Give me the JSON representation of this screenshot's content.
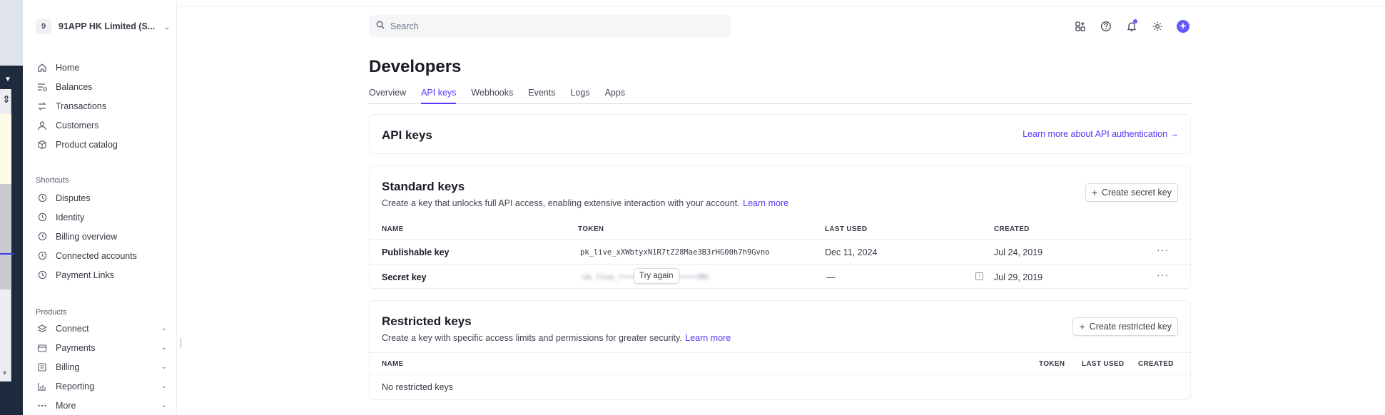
{
  "account": {
    "initial": "9",
    "name": "91APP HK Limited (S..."
  },
  "nav_main": [
    {
      "label": "Home",
      "icon": "home-icon"
    },
    {
      "label": "Balances",
      "icon": "balances-icon"
    },
    {
      "label": "Transactions",
      "icon": "transactions-icon"
    },
    {
      "label": "Customers",
      "icon": "customers-icon"
    },
    {
      "label": "Product catalog",
      "icon": "product-catalog-icon"
    }
  ],
  "shortcuts": {
    "title": "Shortcuts",
    "items": [
      {
        "label": "Disputes"
      },
      {
        "label": "Identity"
      },
      {
        "label": "Billing overview"
      },
      {
        "label": "Connected accounts"
      },
      {
        "label": "Payment Links"
      }
    ]
  },
  "products": {
    "title": "Products",
    "items": [
      {
        "label": "Connect",
        "icon": "connect-icon"
      },
      {
        "label": "Payments",
        "icon": "payments-icon"
      },
      {
        "label": "Billing",
        "icon": "billing-icon"
      },
      {
        "label": "Reporting",
        "icon": "reporting-icon"
      },
      {
        "label": "More",
        "icon": "more-dots-icon"
      }
    ]
  },
  "search": {
    "placeholder": "Search"
  },
  "page": {
    "title": "Developers"
  },
  "tabs": [
    "Overview",
    "API keys",
    "Webhooks",
    "Events",
    "Logs",
    "Apps"
  ],
  "active_tab": "API keys",
  "api_card": {
    "title": "API keys",
    "link": "Learn more about API authentication →"
  },
  "standard": {
    "title": "Standard keys",
    "desc": "Create a key that unlocks full API access, enabling extensive interaction with your account.",
    "learn_more": "Learn more",
    "button": "Create secret key",
    "headers": {
      "name": "NAME",
      "token": "TOKEN",
      "last_used": "LAST USED",
      "created": "CREATED"
    },
    "rows": [
      {
        "name": "Publishable key",
        "token": "pk_live_xXWbtyxN1R7tZ28Mae3B3rHG00h7h9Gvno",
        "last_used": "Dec 11, 2024",
        "created": "Jul 24, 2019"
      },
      {
        "name": "Secret key",
        "token": "sk_live_••••••••••••••••••Mn",
        "try_again": "Try again",
        "last_used": "—",
        "created": "Jul 29, 2019"
      }
    ]
  },
  "restricted": {
    "title": "Restricted keys",
    "desc": "Create a key with specific access limits and permissions for greater security.",
    "learn_more": "Learn more",
    "button": "Create restricted key",
    "headers": {
      "name": "NAME",
      "token": "TOKEN",
      "last_used": "LAST USED",
      "created": "CREATED"
    },
    "empty": "No restricted keys"
  },
  "colors": {
    "accent": "#533afd",
    "host_dark": "#1e2a3d"
  }
}
